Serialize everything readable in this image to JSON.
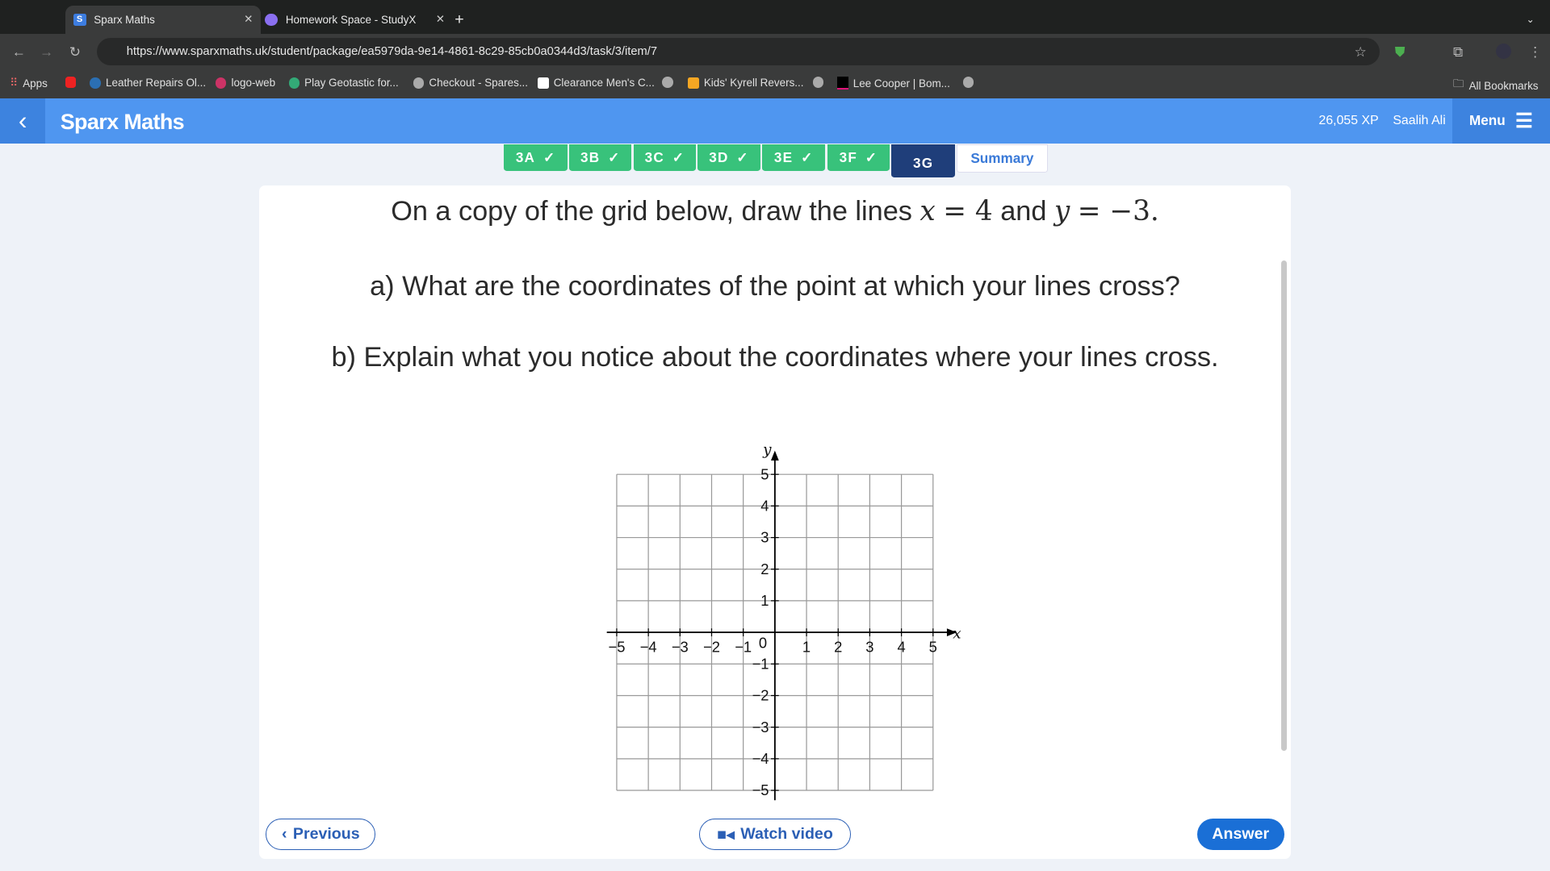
{
  "browser": {
    "tabs": [
      {
        "title": "Sparx Maths",
        "favicon": "S"
      },
      {
        "title": "Homework Space - StudyX"
      }
    ],
    "url": "https://www.sparxmaths.uk/student/package/ea5979da-9e14-4861-8c29-85cb0a0344d3/task/3/item/7",
    "bookmarks": [
      "Apps",
      "Leather Repairs Ol...",
      "logo-web",
      "Play Geotastic for...",
      "Checkout - Spares...",
      "Clearance Men's C...",
      "Kids' Kyrell Revers...",
      "Lee Cooper | Bom..."
    ],
    "all_bookmarks": "All Bookmarks"
  },
  "app": {
    "title": "Sparx Maths",
    "xp": "26,055 XP",
    "user": "Saalih Ali",
    "menu": "Menu"
  },
  "task_tabs": [
    {
      "label": "3A",
      "done": true
    },
    {
      "label": "3B",
      "done": true
    },
    {
      "label": "3C",
      "done": true
    },
    {
      "label": "3D",
      "done": true
    },
    {
      "label": "3E",
      "done": true
    },
    {
      "label": "3F",
      "done": true
    },
    {
      "label": "3G",
      "active": true
    },
    {
      "label": "Summary"
    }
  ],
  "question": {
    "intro_pre": "On a copy of the grid below, draw the lines ",
    "eq1_var": "x",
    "eq1_rhs": "= 4",
    "intro_mid": " and ",
    "eq2_var": "y",
    "eq2_rhs": "= −3.",
    "part_a": "a) What are the coordinates of the point at which your lines cross?",
    "part_b": "b) Explain what you notice about the coordinates where your lines cross."
  },
  "grid": {
    "x_label": "x",
    "y_label": "y",
    "x_range": [
      -5,
      5
    ],
    "y_range": [
      -5,
      5
    ]
  },
  "footer": {
    "previous": "Previous",
    "watch_video": "Watch video",
    "answer": "Answer"
  },
  "colors": {
    "brand": "#4f96f0",
    "done": "#38c27b",
    "active": "#1f3e7a",
    "answer": "#1a6fd6"
  }
}
